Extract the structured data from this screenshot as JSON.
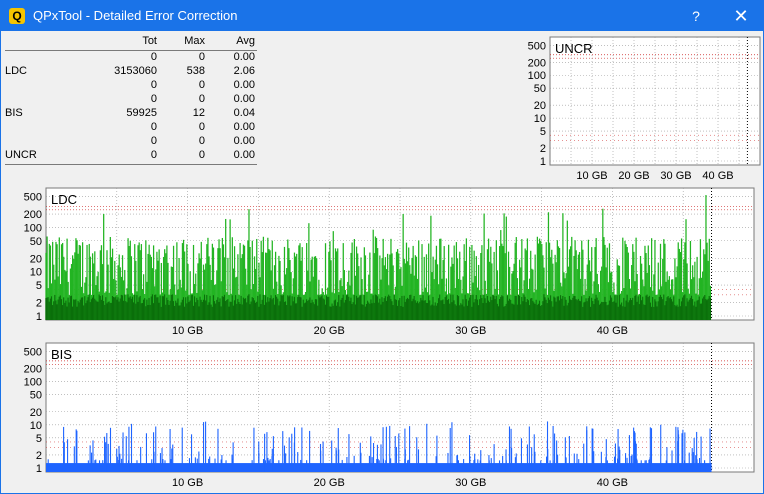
{
  "window": {
    "title": "QPxTool - Detailed Error Correction",
    "help": "?",
    "close": "✕",
    "icon": "Q"
  },
  "stats": {
    "headers": [
      "",
      "Tot",
      "Max",
      "Avg"
    ],
    "rows": [
      [
        "",
        "0",
        "0",
        "0.00"
      ],
      [
        "LDC",
        "3153060",
        "538",
        "2.06"
      ],
      [
        "",
        "0",
        "0",
        "0.00"
      ],
      [
        "",
        "0",
        "0",
        "0.00"
      ],
      [
        "BIS",
        "59925",
        "12",
        "0.04"
      ],
      [
        "",
        "0",
        "0",
        "0.00"
      ],
      [
        "",
        "0",
        "0",
        "0.00"
      ],
      [
        "UNCR",
        "0",
        "0",
        "0.00"
      ]
    ]
  },
  "colors": {
    "ldc_light": "#22b422",
    "ldc_dark": "#0a6e0a",
    "bis": "#1e64ff",
    "grid": "#9a9a9a",
    "limit_red": "#cc2222",
    "titlebar": "#1a73e8"
  },
  "chart_data": [
    {
      "type": "bar",
      "title": "UNCR",
      "y_ticks": [
        "500",
        "200",
        "100",
        "50",
        "20",
        "10",
        "5",
        "2",
        "1"
      ],
      "x_ticks": [
        "10 GB",
        "20 GB",
        "30 GB",
        "40 GB"
      ],
      "y_scale": "log",
      "grid": true,
      "x_range_gb": [
        0,
        50
      ],
      "end_marker_gb": 47,
      "series": [
        {
          "values_max": 0
        }
      ]
    },
    {
      "type": "bar",
      "title": "LDC",
      "y_ticks": [
        "500",
        "200",
        "100",
        "50",
        "20",
        "10",
        "5",
        "2",
        "1"
      ],
      "x_ticks": [
        "10 GB",
        "20 GB",
        "30 GB",
        "40 GB"
      ],
      "y_scale": "log",
      "grid": true,
      "x_range_gb": [
        0,
        50
      ],
      "end_marker_gb": 47,
      "series": [
        {
          "name": "LDC",
          "max": 538,
          "avg": 2.06,
          "typical_peak_range": [
            5,
            50
          ],
          "typical_base": 2
        }
      ]
    },
    {
      "type": "bar",
      "title": "BIS",
      "y_ticks": [
        "500",
        "200",
        "100",
        "50",
        "20",
        "10",
        "5",
        "2",
        "1"
      ],
      "x_ticks": [
        "10 GB",
        "20 GB",
        "30 GB",
        "40 GB"
      ],
      "y_scale": "log",
      "grid": true,
      "x_range_gb": [
        0,
        50
      ],
      "end_marker_gb": 47,
      "series": [
        {
          "name": "BIS",
          "max": 12,
          "avg": 0.04,
          "typical_base": 1
        }
      ]
    }
  ]
}
